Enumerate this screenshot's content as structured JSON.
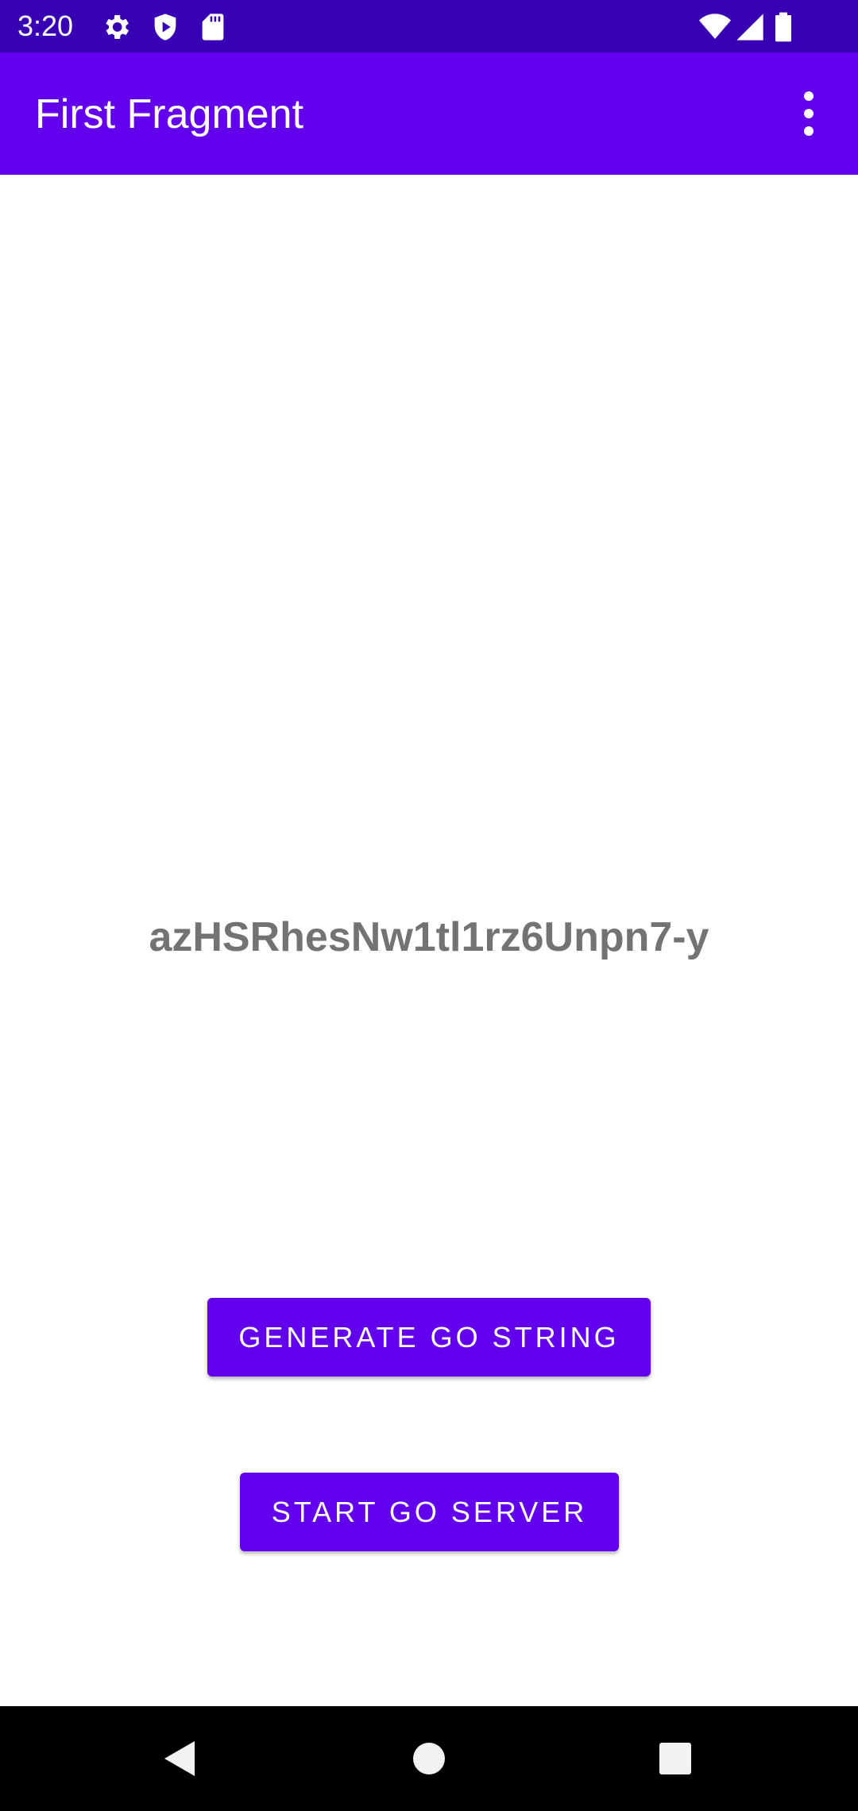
{
  "status_bar": {
    "time": "3:20",
    "left_icons": [
      "gear-icon",
      "shield-play-icon",
      "sd-card-icon"
    ],
    "right_icons": [
      "wifi-icon",
      "cell-signal-icon",
      "battery-icon"
    ]
  },
  "app_bar": {
    "title": "First Fragment",
    "overflow_icon": "more-vert-icon"
  },
  "content": {
    "generated_string": "azHSRhesNw1tl1rz6Unpn7-y",
    "generate_button_label": "GENERATE GO STRING",
    "server_button_label": "START GO SERVER"
  },
  "nav_bar": {
    "icons": [
      "back-icon",
      "home-icon",
      "recents-icon"
    ]
  },
  "colors": {
    "status_bar": "#3700B3",
    "primary": "#6200EE",
    "text_secondary": "#737373",
    "nav_bar": "#000000"
  }
}
